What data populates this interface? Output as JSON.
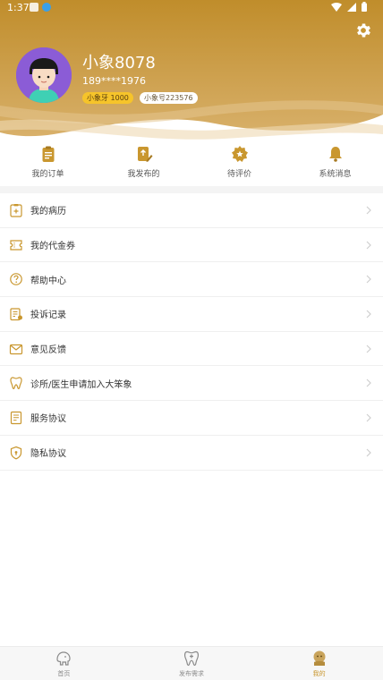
{
  "status_bar": {
    "time": "1:37"
  },
  "profile": {
    "name": "小象8078",
    "phone": "189****1976",
    "coins_badge": "小象牙 1000",
    "id_badge": "小象号223576"
  },
  "quick_actions": [
    {
      "label": "我的订单",
      "icon": "clipboard-icon"
    },
    {
      "label": "我发布的",
      "icon": "edit-document-icon"
    },
    {
      "label": "待评价",
      "icon": "review-badge-icon"
    },
    {
      "label": "系统消息",
      "icon": "bell-icon"
    }
  ],
  "menu": [
    {
      "label": "我的病历",
      "icon": "medical-record-icon"
    },
    {
      "label": "我的代金券",
      "icon": "coupon-icon"
    },
    {
      "label": "帮助中心",
      "icon": "help-icon"
    },
    {
      "label": "投诉记录",
      "icon": "complaint-icon"
    },
    {
      "label": "意见反馈",
      "icon": "feedback-mail-icon"
    },
    {
      "label": "诊所/医生申请加入大笨象",
      "icon": "tooth-icon"
    },
    {
      "label": "服务协议",
      "icon": "agreement-icon"
    },
    {
      "label": "隐私协议",
      "icon": "privacy-shield-icon"
    }
  ],
  "bottom_nav": [
    {
      "label": "首页",
      "icon": "home-elephant-icon",
      "active": false
    },
    {
      "label": "发布需求",
      "icon": "tooth-plus-icon",
      "active": false
    },
    {
      "label": "我的",
      "icon": "profile-elephant-icon",
      "active": true
    }
  ],
  "colors": {
    "gold_header": "#c9972f",
    "gold_icon": "#c9972f",
    "coin_badge": "#f6c42a",
    "active_tab": "#c9972f"
  }
}
